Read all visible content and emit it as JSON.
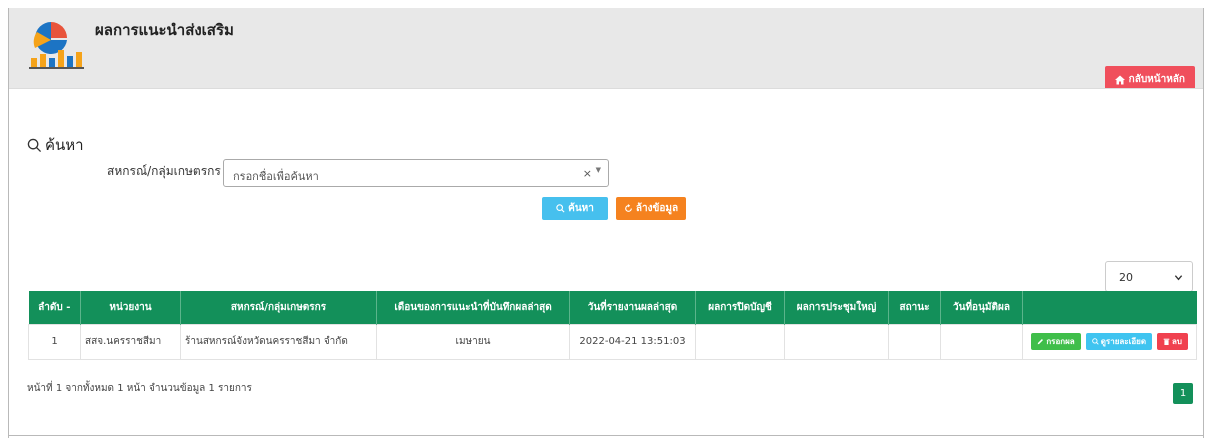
{
  "header": {
    "title": "ผลการแนะนำส่งเสริม",
    "home_button": "กลับหน้าหลัก"
  },
  "search": {
    "heading": "ค้นหา",
    "filter_label": "สหกรณ์/กลุ่มเกษตรกร",
    "placeholder": "กรอกชื่อเพื่อค้นหา",
    "clear_symbol": "×",
    "search_button": "ค้นหา",
    "clear_button": "ล้างข้อมูล"
  },
  "page_size": "20",
  "table": {
    "headers": [
      "ลำดับ -",
      "หน่วยงาน",
      "สหกรณ์/กลุ่มเกษตรกร",
      "เดือนของการแนะนำที่บันทึกผลล่าสุด",
      "วันที่รายงานผลล่าสุด",
      "ผลการปิดบัญชี",
      "ผลการประชุมใหญ่",
      "สถานะ",
      "วันที่อนุมัติผล",
      ""
    ],
    "rows": [
      {
        "no": "1",
        "agency": "สสจ.นครราชสีมา",
        "coop": "ร้านสหกรณ์จังหวัดนครราชสีมา จำกัด",
        "month": "เมษายน",
        "report_date": "2022-04-21 13:51:03",
        "closing": "",
        "meeting": "",
        "status": "",
        "approve_date": ""
      }
    ],
    "actions": {
      "edit": "กรอกผล",
      "detail": "ดูรายละเอียด",
      "delete": "ลบ"
    }
  },
  "summary": "หน้าที่ 1 จากทั้งหมด 1 หน้า จำนวนข้อมูล 1 รายการ",
  "pagination": {
    "current": "1"
  },
  "colors": {
    "header_bg": "#e8e8e8",
    "table_header": "#13905a",
    "home_button": "#f04f5c",
    "search_button": "#46c0ee",
    "clear_button": "#f5821f",
    "edit_button": "#3fbe4a",
    "detail_button": "#3fc4f0",
    "delete_button": "#f0414f"
  }
}
